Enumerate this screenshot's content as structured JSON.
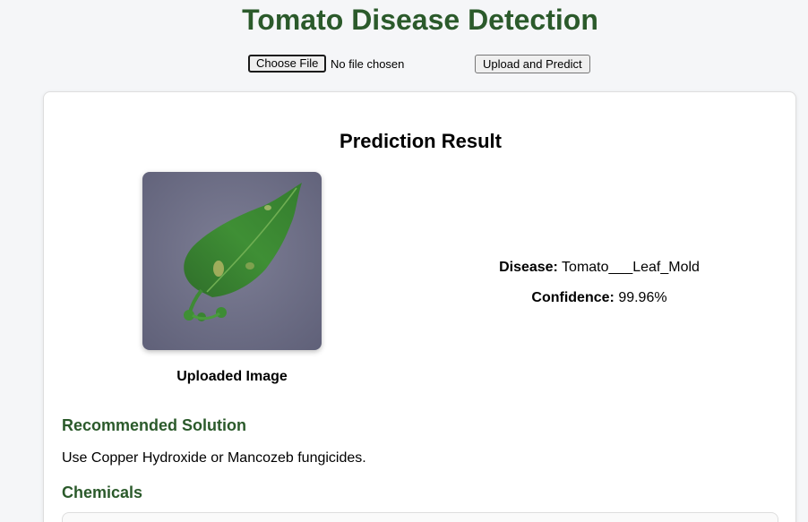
{
  "header": {
    "title": "Tomato Disease Detection"
  },
  "upload": {
    "choose_file_label": "Choose File",
    "file_status": "No file chosen",
    "predict_label": "Upload and Predict"
  },
  "result": {
    "heading": "Prediction Result",
    "image_caption": "Uploaded Image",
    "disease_label": "Disease:",
    "disease_value": "Tomato___Leaf_Mold",
    "confidence_label": "Confidence:",
    "confidence_value": "99.96%"
  },
  "solution": {
    "heading": "Recommended Solution",
    "text": "Use Copper Hydroxide or Mancozeb fungicides."
  },
  "chemicals": {
    "heading": "Chemicals"
  },
  "colors": {
    "accent_green": "#2b5a2b",
    "background": "#f5f6f8",
    "card": "#ffffff"
  }
}
